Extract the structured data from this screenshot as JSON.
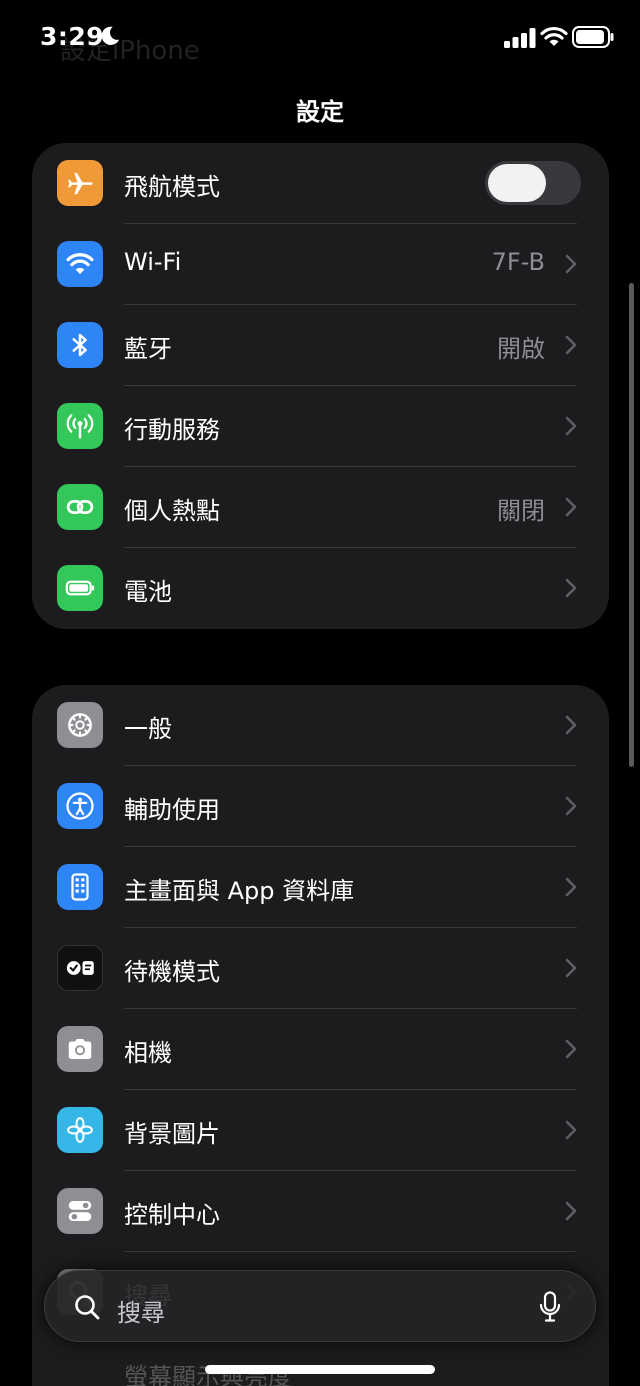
{
  "status_bar": {
    "time": "3:29",
    "ghost_title": "設定iPhone"
  },
  "header": {
    "title": "設定"
  },
  "group1": [
    {
      "label": "飛航模式",
      "value": "",
      "icon": "airplane-icon",
      "color": "#f09a37",
      "toggle": true,
      "toggle_on": false
    },
    {
      "label": "Wi-Fi",
      "value": "7F-B",
      "icon": "wifi-icon",
      "color": "#2e86f6"
    },
    {
      "label": "藍牙",
      "value": "開啟",
      "icon": "bluetooth-icon",
      "color": "#2e86f6"
    },
    {
      "label": "行動服務",
      "value": "",
      "icon": "cellular-icon",
      "color": "#34c759"
    },
    {
      "label": "個人熱點",
      "value": "關閉",
      "icon": "hotspot-icon",
      "color": "#34c759"
    },
    {
      "label": "電池",
      "value": "",
      "icon": "battery-icon",
      "color": "#34c759"
    }
  ],
  "group2": [
    {
      "label": "一般",
      "icon": "gear-icon",
      "color": "#8e8e93"
    },
    {
      "label": "輔助使用",
      "icon": "accessibility-icon",
      "color": "#2e86f6"
    },
    {
      "label": "主畫面與 App 資料庫",
      "icon": "home-screen-icon",
      "color": "#2e86f6"
    },
    {
      "label": "待機模式",
      "icon": "standby-icon",
      "color": "#111111"
    },
    {
      "label": "相機",
      "icon": "camera-icon",
      "color": "#8e8e93"
    },
    {
      "label": "背景圖片",
      "icon": "wallpaper-icon",
      "color": "#35b8e8"
    },
    {
      "label": "控制中心",
      "icon": "control-center-icon",
      "color": "#8e8e93"
    },
    {
      "label": "搜尋",
      "icon": "search-app-icon",
      "color": "#8e8e93"
    }
  ],
  "search": {
    "placeholder": "搜尋"
  },
  "ghost_row": {
    "label": "螢幕顯示與亮度"
  }
}
